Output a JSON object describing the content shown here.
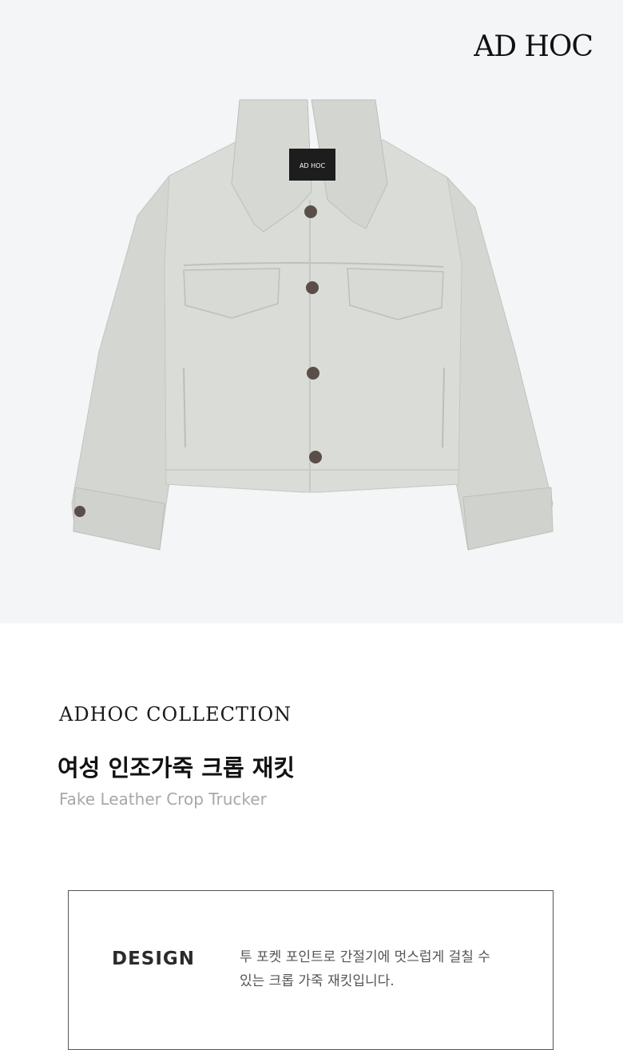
{
  "hero": {
    "brand_logo": "AD HOC",
    "label_tag": "AD HOC",
    "background_color": "#f4f5f7",
    "jacket_color": "#d9dbd7"
  },
  "product": {
    "collection": "ADHOC  COLLECTION",
    "title_ko": "여성 인조가죽 크롭 재킷",
    "title_en": "Fake Leather Crop Trucker"
  },
  "details": {
    "design_label": "DESIGN",
    "design_line1": "투 포켓 포인트로 간절기에 멋스럽게 걸칠 수",
    "design_line2": "있는 크롭 가죽 재킷입니다."
  }
}
